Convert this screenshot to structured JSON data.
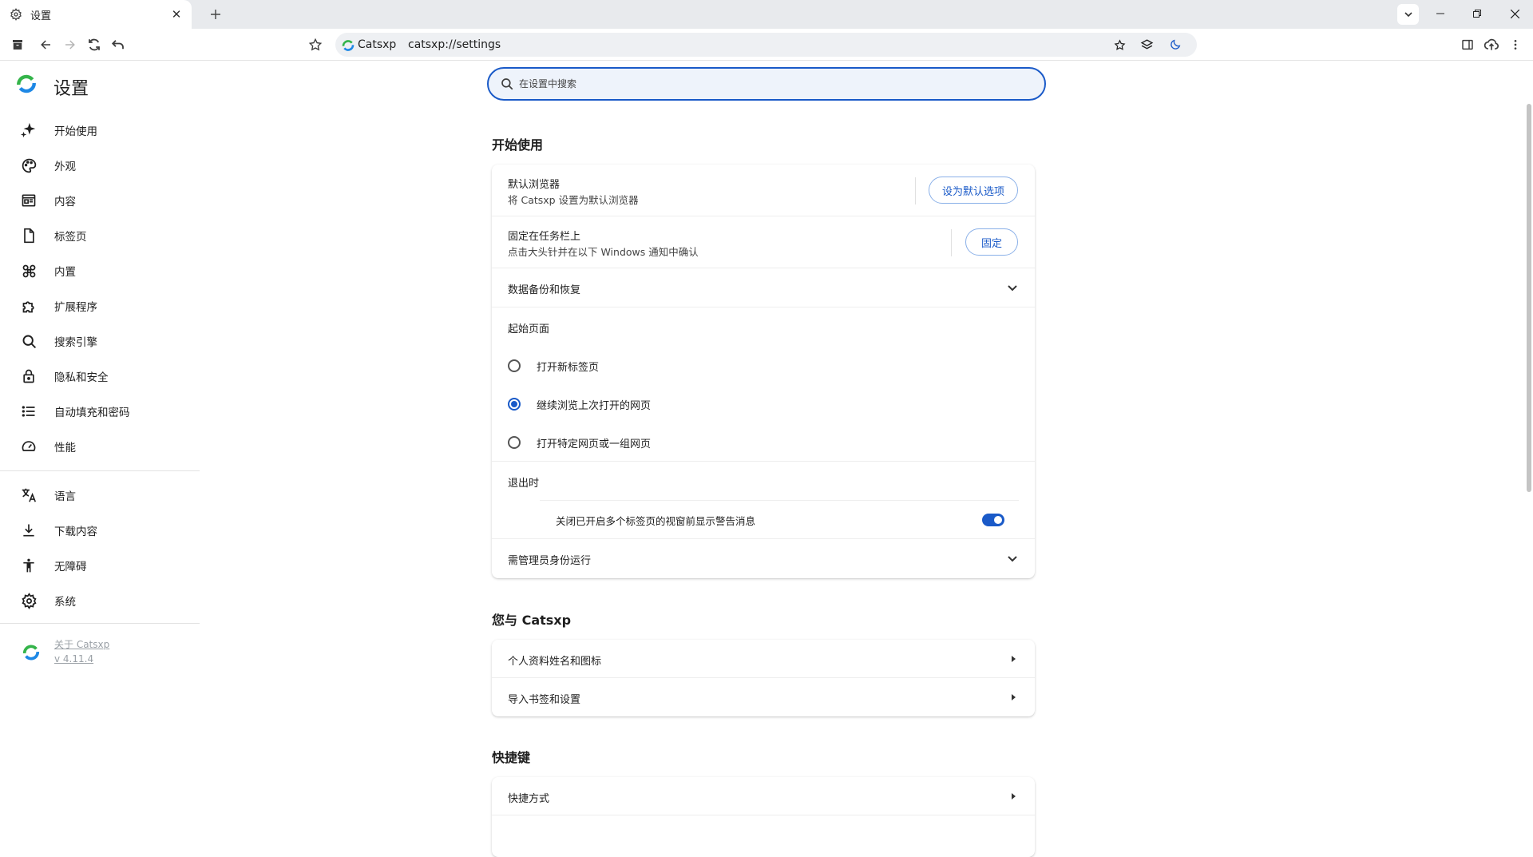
{
  "browser": {
    "tab_title": "设置",
    "address_brand": "Catsxp",
    "address_url": "catsxp://settings"
  },
  "sidebar": {
    "title": "设置",
    "items": [
      {
        "label": "开始使用",
        "icon": "sparkle-icon"
      },
      {
        "label": "外观",
        "icon": "palette-icon"
      },
      {
        "label": "内容",
        "icon": "content-icon"
      },
      {
        "label": "标签页",
        "icon": "page-icon"
      },
      {
        "label": "内置",
        "icon": "command-icon"
      },
      {
        "label": "扩展程序",
        "icon": "puzzle-icon"
      },
      {
        "label": "搜索引擎",
        "icon": "search-icon"
      },
      {
        "label": "隐私和安全",
        "icon": "lock-icon"
      },
      {
        "label": "自动填充和密码",
        "icon": "list-icon"
      },
      {
        "label": "性能",
        "icon": "speedometer-icon"
      },
      {
        "label": "语言",
        "icon": "translate-icon"
      },
      {
        "label": "下载内容",
        "icon": "download-icon"
      },
      {
        "label": "无障碍",
        "icon": "accessibility-icon"
      },
      {
        "label": "系统",
        "icon": "gear-icon"
      }
    ],
    "about_name": "关于 Catsxp",
    "about_version": "v 4.11.4"
  },
  "search": {
    "placeholder": "在设置中搜索"
  },
  "sections": {
    "get_started": {
      "title": "开始使用",
      "default_browser": {
        "title": "默认浏览器",
        "subtitle": "将 Catsxp 设置为默认浏览器",
        "button": "设为默认选项"
      },
      "pin_taskbar": {
        "title": "固定在任务栏上",
        "subtitle": "点击大头针并在以下 Windows 通知中确认",
        "button": "固定"
      },
      "backup": {
        "title": "数据备份和恢复"
      },
      "startup": {
        "title": "起始页面",
        "options": [
          "打开新标签页",
          "继续浏览上次打开的网页",
          "打开特定网页或一组网页"
        ],
        "selected": 1
      },
      "on_exit": {
        "title": "退出时",
        "warn_label": "关闭已开启多个标签页的视窗前显示警告消息",
        "warn_enabled": true
      },
      "admin": {
        "title": "需管理员身份运行"
      }
    },
    "you_and": {
      "title": "您与 Catsxp",
      "rows": [
        "个人资料姓名和图标",
        "导入书签和设置"
      ]
    },
    "shortcuts": {
      "title": "快捷键",
      "rows": [
        "快捷方式"
      ]
    }
  },
  "colors": {
    "accent": "#1a5ac8",
    "brand_green": "#34b44a",
    "brand_blue": "#1e88e5"
  }
}
